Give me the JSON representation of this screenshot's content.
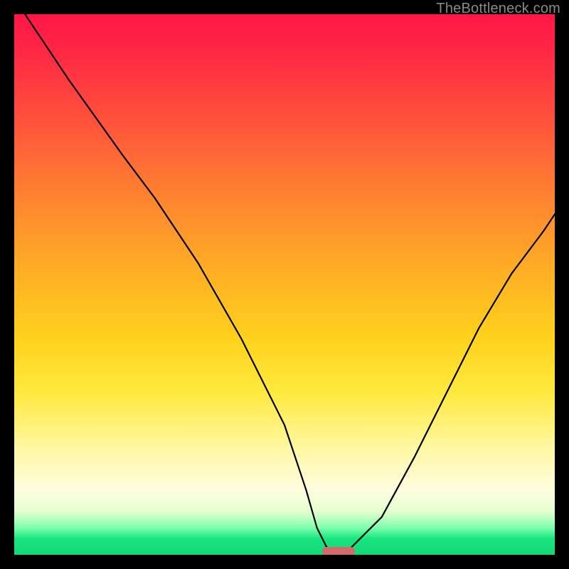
{
  "attribution": "TheBottleneck.com",
  "chart_data": {
    "type": "line",
    "title": "",
    "xlabel": "",
    "ylabel": "",
    "xlim": [
      0,
      100
    ],
    "ylim": [
      0,
      100
    ],
    "grid": false,
    "legend": false,
    "series": [
      {
        "name": "bottleneck-curve",
        "x": [
          2,
          10,
          20,
          26,
          34,
          42,
          50,
          54,
          56,
          58,
          60,
          62,
          68,
          74,
          80,
          86,
          92,
          98,
          100
        ],
        "y": [
          100,
          88,
          74,
          66,
          54,
          40,
          24,
          12,
          5,
          1,
          0,
          1,
          7,
          18,
          30,
          42,
          52,
          60,
          63
        ]
      }
    ],
    "marker": {
      "name": "optimal-range",
      "x_start": 57,
      "x_end": 63,
      "y": 0,
      "color": "#d46a6a"
    },
    "background_gradient": {
      "top": "#ff1648",
      "mid": "#ffd21c",
      "bottom": "#13d877"
    }
  }
}
